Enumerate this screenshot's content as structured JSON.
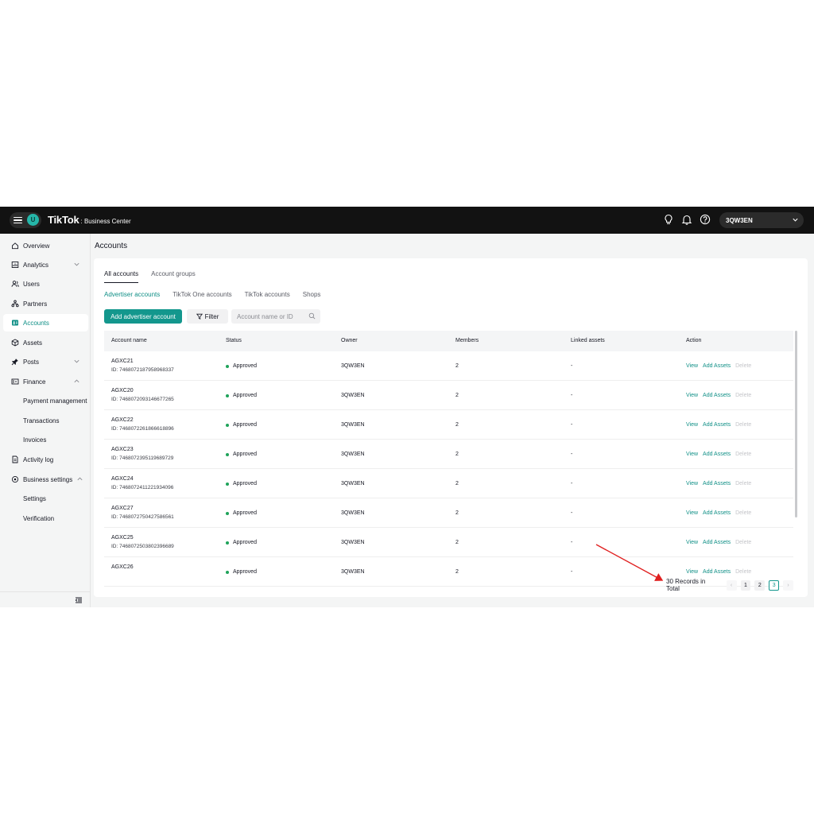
{
  "topbar": {
    "avatar_letter": "U",
    "brand_main": "TikTok",
    "brand_sub": ": Business Center",
    "account_name": "3QW3EN"
  },
  "sidebar": {
    "items": [
      {
        "label": "Overview",
        "icon": "home-icon"
      },
      {
        "label": "Analytics",
        "icon": "chart-icon"
      },
      {
        "label": "Users",
        "icon": "users-icon"
      },
      {
        "label": "Partners",
        "icon": "partners-icon"
      },
      {
        "label": "Accounts",
        "icon": "accounts-icon"
      },
      {
        "label": "Assets",
        "icon": "cube-icon"
      },
      {
        "label": "Posts",
        "icon": "pin-icon"
      },
      {
        "label": "Finance",
        "icon": "wallet-icon"
      },
      {
        "label": "Payment management"
      },
      {
        "label": "Transactions"
      },
      {
        "label": "Invoices"
      },
      {
        "label": "Activity log",
        "icon": "doc-icon"
      },
      {
        "label": "Business settings",
        "icon": "gear-icon"
      },
      {
        "label": "Settings"
      },
      {
        "label": "Verification"
      }
    ]
  },
  "main": {
    "title": "Accounts",
    "tabs": [
      "All accounts",
      "Account groups"
    ],
    "subtabs": [
      "Advertiser accounts",
      "TikTok One accounts",
      "TikTok accounts",
      "Shops"
    ],
    "add_button": "Add advertiser account",
    "filter_button": "Filter",
    "search_placeholder": "Account name or ID",
    "columns": [
      "Account name",
      "Status",
      "Owner",
      "Members",
      "Linked assets",
      "Action"
    ],
    "rows": [
      {
        "name": "AGXC21",
        "id": "ID: 7468072187958968337",
        "status": "Approved",
        "owner": "3QW3EN",
        "members": "2",
        "linked": "-"
      },
      {
        "name": "AGXC20",
        "id": "ID: 7468072093146677265",
        "status": "Approved",
        "owner": "3QW3EN",
        "members": "2",
        "linked": "-"
      },
      {
        "name": "AGXC22",
        "id": "ID: 7468072261866618896",
        "status": "Approved",
        "owner": "3QW3EN",
        "members": "2",
        "linked": "-"
      },
      {
        "name": "AGXC23",
        "id": "ID: 7468072395119689729",
        "status": "Approved",
        "owner": "3QW3EN",
        "members": "2",
        "linked": "-"
      },
      {
        "name": "AGXC24",
        "id": "ID: 7468072411221934096",
        "status": "Approved",
        "owner": "3QW3EN",
        "members": "2",
        "linked": "-"
      },
      {
        "name": "AGXC27",
        "id": "ID: 7468072750427586561",
        "status": "Approved",
        "owner": "3QW3EN",
        "members": "2",
        "linked": "-"
      },
      {
        "name": "AGXC25",
        "id": "ID: 7468072503802396689",
        "status": "Approved",
        "owner": "3QW3EN",
        "members": "2",
        "linked": "-"
      },
      {
        "name": "AGXC26",
        "id": "",
        "status": "Approved",
        "owner": "3QW3EN",
        "members": "2",
        "linked": "-"
      }
    ],
    "actions": {
      "view": "View",
      "add_assets": "Add Assets",
      "delete": "Delete"
    },
    "pagination": {
      "total": "30 Records in Total",
      "prev": "‹",
      "pages": [
        "1",
        "2",
        "3"
      ],
      "current": "3",
      "next": "›"
    }
  },
  "colors": {
    "accent": "#13978d",
    "topbar": "#121212",
    "status_ok": "#1fa35a",
    "annotation_arrow": "#e02020"
  }
}
